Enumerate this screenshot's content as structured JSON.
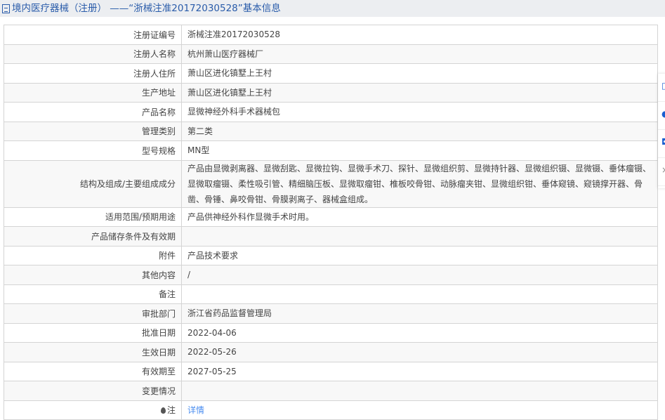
{
  "header": {
    "title": "境内医疗器械（注册） ——“浙械注准20172030528”基本信息"
  },
  "rows": [
    {
      "label": "注册证编号",
      "value": "浙械注准20172030528"
    },
    {
      "label": "注册人名称",
      "value": "杭州萧山医疗器械厂"
    },
    {
      "label": "注册人住所",
      "value": "萧山区进化镇墅上王村"
    },
    {
      "label": "生产地址",
      "value": "萧山区进化镇墅上王村"
    },
    {
      "label": "产品名称",
      "value": "显微神经外科手术器械包"
    },
    {
      "label": "管理类别",
      "value": "第二类"
    },
    {
      "label": "型号规格",
      "value": "MN型"
    },
    {
      "label": "结构及组成/主要组成成分",
      "value": "产品由显微剥离器、显微刮匙、显微拉钩、显微手术刀、探针、显微组织剪、显微持针器、显微组织镊、显微镊、垂体瘤镊、显微取瘤镊、柔性吸引管、精细脑压板、显微取瘤钳、椎板咬骨钳、动脉瘤夹钳、显微组织钳、垂体窥镜、窥镜撑开器、骨凿、骨锤、鼻咬骨钳、骨膜剥离子、器械盒组成。"
    },
    {
      "label": "适用范围/预期用途",
      "value": "产品供神经外科作显微手术时用。"
    },
    {
      "label": "产品储存条件及有效期",
      "value": ""
    },
    {
      "label": "附件",
      "value": "产品技术要求"
    },
    {
      "label": "其他内容",
      "value": "/"
    },
    {
      "label": "备注",
      "value": ""
    },
    {
      "label": "审批部门",
      "value": "浙江省药品监督管理局"
    },
    {
      "label": "批准日期",
      "value": "2022-04-06"
    },
    {
      "label": "生效日期",
      "value": "2022-05-26"
    },
    {
      "label": "有效期至",
      "value": "2027-05-25"
    },
    {
      "label": "变更情况",
      "value": ""
    }
  ],
  "note": {
    "label": "注",
    "link": "详情"
  }
}
